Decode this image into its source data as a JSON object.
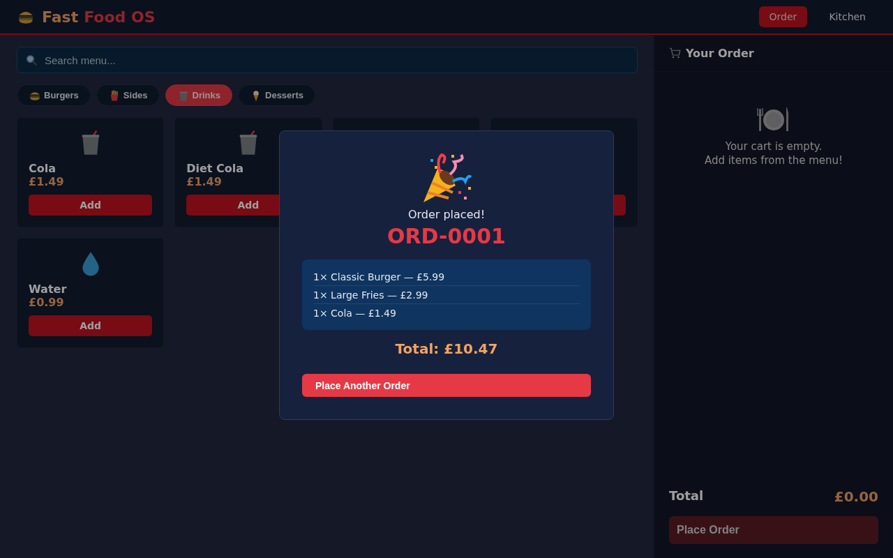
{
  "header": {
    "logo_primary": "Fast",
    "logo_accent": "Food OS",
    "nav": [
      {
        "label": "Order",
        "selected": true
      },
      {
        "label": "Kitchen",
        "selected": false
      }
    ]
  },
  "search": {
    "placeholder": "Search menu..."
  },
  "categories": [
    {
      "label": "Burgers",
      "kind": "burger",
      "selected": false
    },
    {
      "label": "Sides",
      "kind": "fries",
      "selected": false
    },
    {
      "label": "Drinks",
      "kind": "cup",
      "selected": true
    },
    {
      "label": "Desserts",
      "kind": "icecream",
      "selected": false
    }
  ],
  "menu": [
    {
      "kind": "cup",
      "name": "Cola",
      "price": "£1.49",
      "button": "Add"
    },
    {
      "kind": "cup",
      "name": "Diet Cola",
      "price": "£1.49",
      "button": "Add"
    },
    {
      "kind": "covered"
    },
    {
      "kind": "covered"
    },
    {
      "kind": "drop",
      "name": "Water",
      "price": "£0.99",
      "button": "Add"
    }
  ],
  "cart": {
    "title": "Your Order",
    "empty_message": "Your cart is empty.\nAdd items from the menu!",
    "total_label": "Total",
    "total_value": "£0.00",
    "button": "Place Order",
    "disabled": true
  },
  "modal": {
    "message": "Order placed!",
    "order_id": "ORD-0001",
    "lines": [
      "1× Classic Burger — £5.99",
      "1× Large Fries — £2.99",
      "1× Cola — £1.49"
    ],
    "total": "Total: £10.47",
    "button": "Place Another Order"
  }
}
